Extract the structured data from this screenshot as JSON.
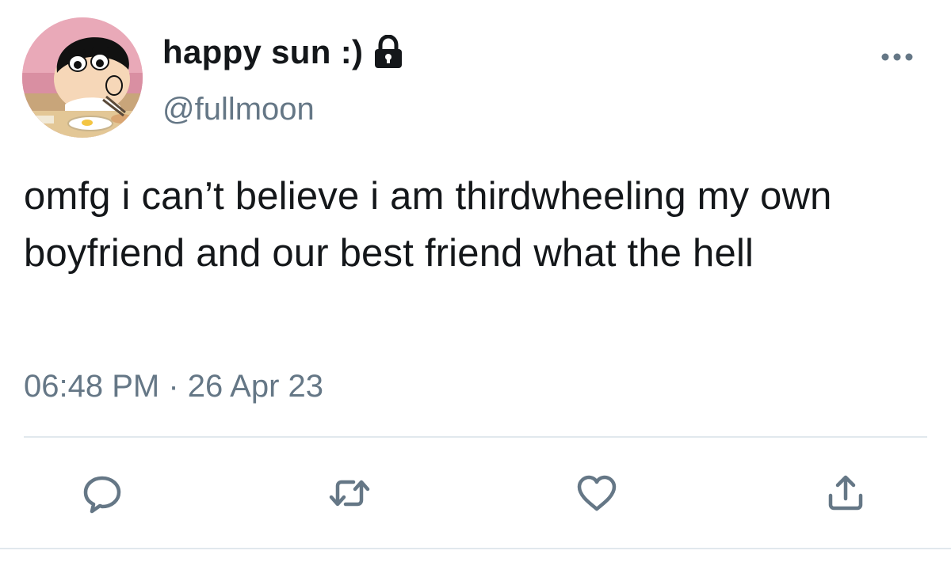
{
  "user": {
    "display_name": "happy sun :)",
    "handle": "@fullmoon",
    "protected_icon": "lock-icon",
    "avatar": "cartoon-avatar"
  },
  "tweet": {
    "text": "omfg i can’t believe i am thirdwheeling my own boyfriend and our best friend what the hell",
    "timestamp": "06:48 PM · 26 Apr 23"
  },
  "actions": {
    "reply_icon": "reply-icon",
    "retweet_icon": "retweet-icon",
    "like_icon": "heart-icon",
    "share_icon": "share-icon",
    "more_icon": "more-icon"
  },
  "colors": {
    "text_primary": "#14171a",
    "text_secondary": "#657786",
    "icon": "#657786",
    "divider": "#e1e8ed",
    "avatar_bg": "#e9a9b8"
  }
}
